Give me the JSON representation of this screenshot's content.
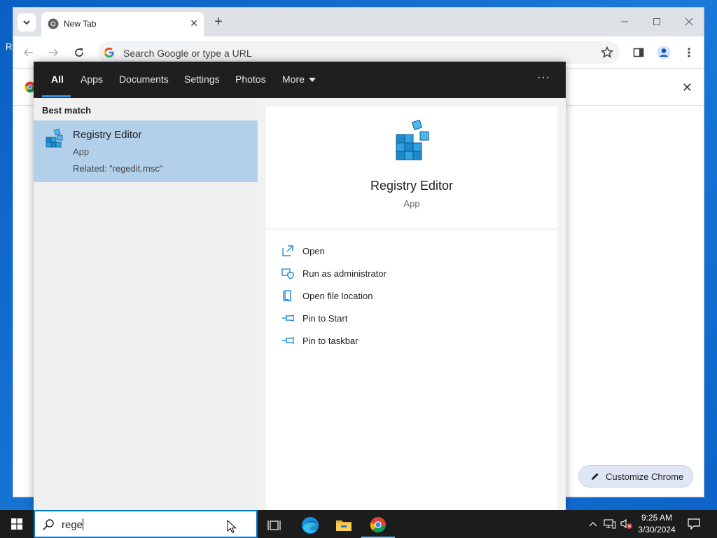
{
  "browser": {
    "tab_title": "New Tab",
    "omnibox_placeholder": "Search Google or type a URL",
    "customize_label": "Customize Chrome"
  },
  "desktop": {
    "partial_label": "R"
  },
  "search_panel": {
    "filters": [
      {
        "label": "All",
        "active": true
      },
      {
        "label": "Apps"
      },
      {
        "label": "Documents"
      },
      {
        "label": "Settings"
      },
      {
        "label": "Photos"
      },
      {
        "label": "More"
      }
    ],
    "options_label": "···",
    "best_match_heading": "Best match",
    "best_match": {
      "title": "Registry Editor",
      "type": "App",
      "related": "Related: \"regedit.msc\""
    },
    "preview": {
      "title": "Registry Editor",
      "type": "App"
    },
    "actions": [
      {
        "label": "Open",
        "icon": "open-icon"
      },
      {
        "label": "Run as administrator",
        "icon": "shield-icon"
      },
      {
        "label": "Open file location",
        "icon": "file-location-icon"
      },
      {
        "label": "Pin to Start",
        "icon": "pin-icon"
      },
      {
        "label": "Pin to taskbar",
        "icon": "pin-icon"
      }
    ]
  },
  "taskbar": {
    "search_value": "rege",
    "clock_time": "9:25 AM",
    "clock_date": "3/30/2024"
  },
  "colors": {
    "accent": "#0078d7",
    "selection": "#b3d0ea",
    "filter_bar": "#1f1f1f",
    "registry_blue": "#1e88c9"
  }
}
